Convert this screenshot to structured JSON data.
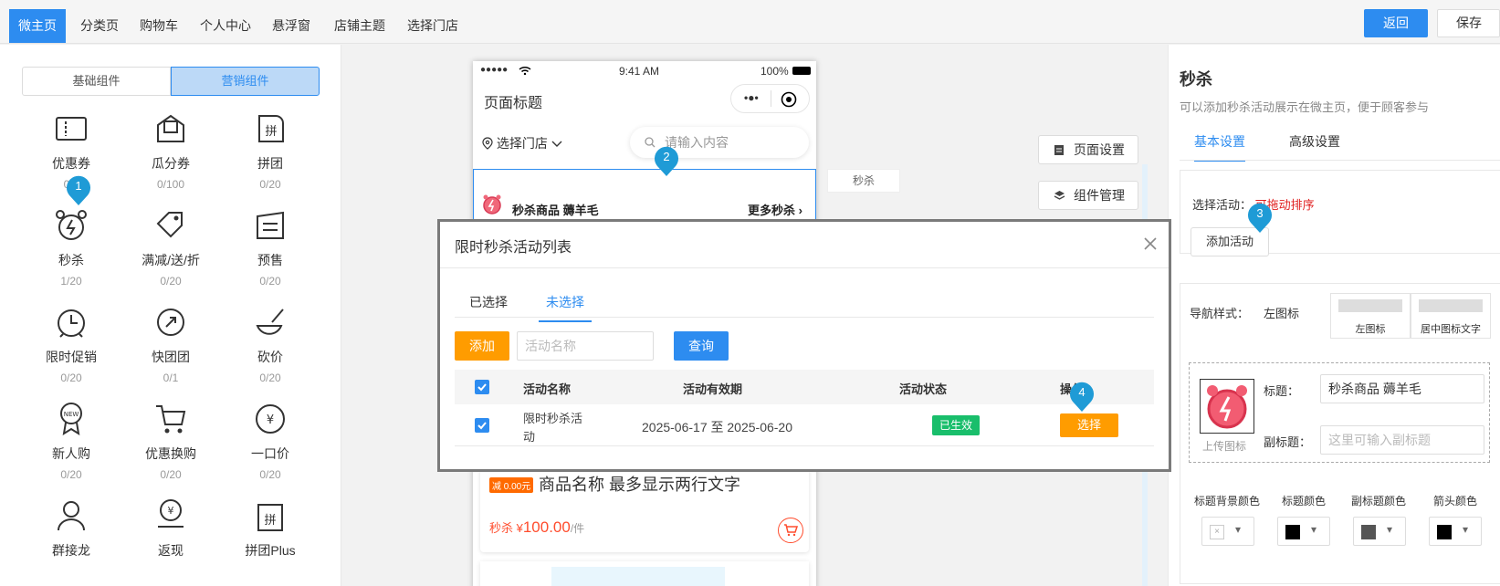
{
  "topnav": {
    "tabs": [
      {
        "label": "微主页",
        "active": true
      },
      {
        "label": "分类页"
      },
      {
        "label": "购物车"
      },
      {
        "label": "个人中心"
      },
      {
        "label": "悬浮窗"
      },
      {
        "label": "店铺主题"
      },
      {
        "label": "选择门店"
      }
    ],
    "back_label": "返回",
    "save_label": "保存"
  },
  "left": {
    "segments": {
      "basic": "基础组件",
      "marketing": "营销组件"
    },
    "components": [
      {
        "name": "优惠券",
        "count": "0/1",
        "icon": "coupon-icon"
      },
      {
        "name": "瓜分券",
        "count": "0/100",
        "icon": "split-coupon-icon"
      },
      {
        "name": "拼团",
        "count": "0/20",
        "icon": "group-buy-icon"
      },
      {
        "name": "秒杀",
        "count": "1/20",
        "icon": "alarm-icon"
      },
      {
        "name": "满减/送/折",
        "count": "0/20",
        "icon": "tag-icon"
      },
      {
        "name": "预售",
        "count": "0/20",
        "icon": "presale-icon"
      },
      {
        "name": "限时促销",
        "count": "0/20",
        "icon": "clock-icon"
      },
      {
        "name": "快团团",
        "count": "0/1",
        "icon": "quick-group-icon"
      },
      {
        "name": "砍价",
        "count": "0/20",
        "icon": "bargain-icon"
      },
      {
        "name": "新人购",
        "count": "0/20",
        "icon": "new-badge-icon"
      },
      {
        "name": "优惠换购",
        "count": "0/20",
        "icon": "cart-exchange-icon"
      },
      {
        "name": "一口价",
        "count": "0/20",
        "icon": "yen-circle-icon"
      },
      {
        "name": "群接龙",
        "count": "",
        "icon": "users-icon"
      },
      {
        "name": "返现",
        "count": "",
        "icon": "cashback-icon"
      },
      {
        "name": "拼团Plus",
        "count": "",
        "icon": "group-plus-icon"
      }
    ]
  },
  "phone": {
    "status": {
      "signal": "●●●●●",
      "time": "9:41 AM",
      "battery": "100%"
    },
    "page_title": "页面标题",
    "store_select": "选择门店",
    "search_placeholder": "请输入内容",
    "seckill_title": "秒杀商品 薅羊毛",
    "more_label": "更多秒杀",
    "product": {
      "badge": "减 0.00元",
      "name": "商品名称 最多显示两行文字",
      "price_prefix": "秒杀 ¥",
      "price": "100.00",
      "unit": "/件"
    }
  },
  "side": {
    "page_settings": "页面设置",
    "component_manage": "组件管理",
    "floating_label": "秒杀"
  },
  "pins": [
    "1",
    "2",
    "3",
    "4"
  ],
  "right": {
    "title": "秒杀",
    "desc": "可以添加秒杀活动展示在微主页，便于顾客参与",
    "tabs": {
      "basic": "基本设置",
      "advanced": "高级设置"
    },
    "select_activity": "选择活动：",
    "draggable_hint": "可拖动排序",
    "add_activity": "添加活动",
    "nav_style_label": "导航样式：",
    "nav_style_value": "左图标",
    "nav_options": [
      "左图标",
      "居中图标文字"
    ],
    "upload_label": "上传图标",
    "title_label": "标题：",
    "title_value": "秒杀商品 薅羊毛",
    "subtitle_label": "副标题：",
    "subtitle_placeholder": "这里可输入副标题",
    "color_labels": [
      "标题背景颜色",
      "标题颜色",
      "副标题颜色",
      "箭头颜色"
    ],
    "colors": [
      "#ffffff",
      "#000000",
      "#555555",
      "#000000"
    ]
  },
  "modal": {
    "title": "限时秒杀活动列表",
    "tabs": {
      "selected": "已选择",
      "unselected": "未选择"
    },
    "add_label": "添加",
    "name_placeholder": "活动名称",
    "query_label": "查询",
    "columns": [
      "活动名称",
      "活动有效期",
      "活动状态",
      "操作"
    ],
    "rows": [
      {
        "name_line1": "限时秒杀活",
        "name_line2": "动",
        "period": "2025-06-17 至 2025-06-20",
        "status": "已生效",
        "action": "选择"
      }
    ]
  },
  "colors": {
    "primary": "#2d8cf0",
    "orange": "#ff9c00",
    "green": "#19be6b",
    "red": "#e02020"
  }
}
